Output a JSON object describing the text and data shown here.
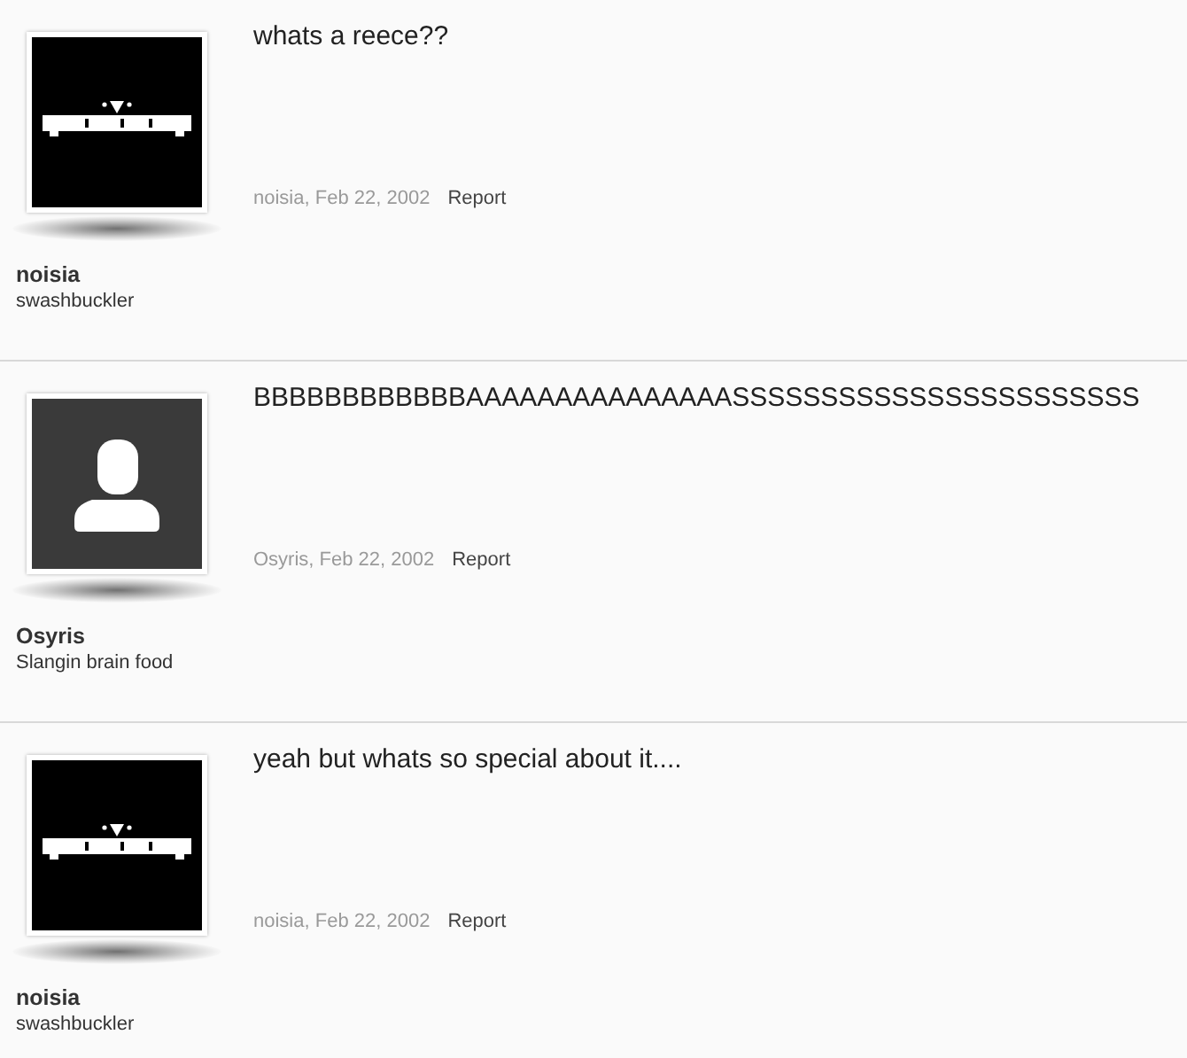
{
  "posts": [
    {
      "username": "noisia",
      "user_title": "swashbuckler",
      "message": "whats a reece??",
      "meta": "noisia, Feb 22, 2002",
      "report": "Report"
    },
    {
      "avatar": {
        "kind": "default"
      },
      "username": "Osyris",
      "user_title": "Slangin brain food",
      "message": "BBBBBBBBBBBBAAAAAAAAAAAAAAASSSSSSSSSSSSSSSSSSSSSSS",
      "meta": "Osyris, Feb 22, 2002",
      "report": "Report"
    },
    {
      "username": "noisia",
      "user_title": "swashbuckler",
      "message": "yeah but whats so special about it....",
      "meta": "noisia, Feb 22, 2002",
      "report": "Report"
    }
  ]
}
